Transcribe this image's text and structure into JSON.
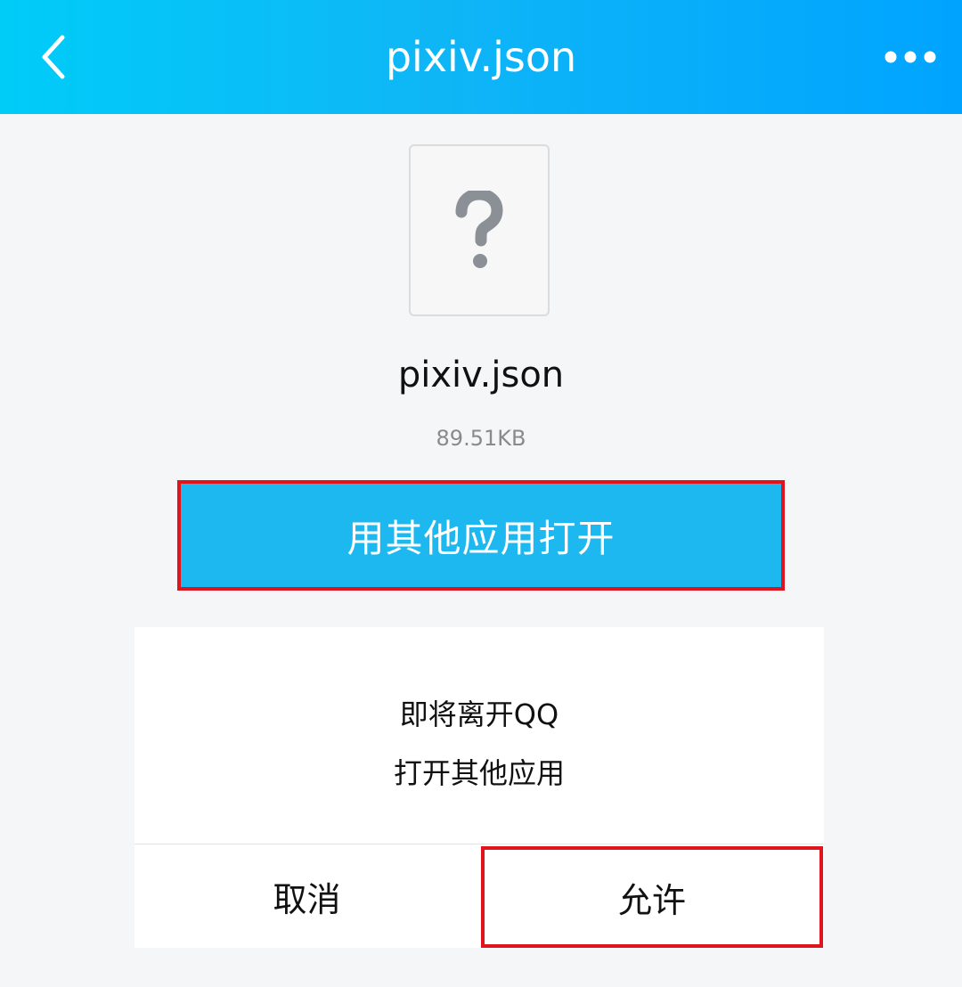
{
  "header": {
    "title": "pixiv.json",
    "back_icon": "chevron-left-icon",
    "more_icon": "more-dots-icon",
    "gradient_start": "#00ccf8",
    "gradient_end": "#00a4ff"
  },
  "file": {
    "icon": "unknown-file-question-icon",
    "name": "pixiv.json",
    "size": "89.51KB"
  },
  "open_button": {
    "label": "用其他应用打开",
    "background": "#1eb8f0",
    "highlight_border": "#e0141c"
  },
  "dialog": {
    "line1": "即将离开QQ",
    "line2": "打开其他应用",
    "cancel_label": "取消",
    "allow_label": "允许"
  }
}
